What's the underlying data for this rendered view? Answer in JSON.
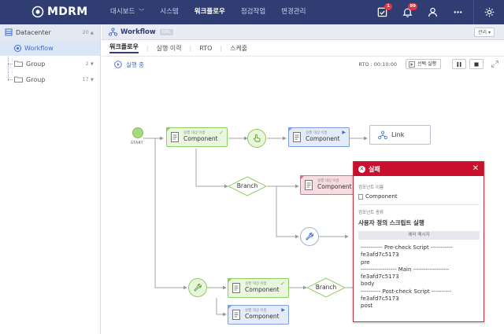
{
  "app": {
    "logo_text": "MDRM"
  },
  "topnav": {
    "items": [
      {
        "label": "대시보드",
        "has_dropdown": true
      },
      {
        "label": "시스템"
      },
      {
        "label": "워크플로우",
        "active": true
      },
      {
        "label": "점검작업"
      },
      {
        "label": "변경관리"
      }
    ],
    "icons": [
      {
        "name": "task-icon",
        "badge": "1"
      },
      {
        "name": "bell-icon",
        "badge": "99"
      },
      {
        "name": "user-icon"
      },
      {
        "name": "more-icon"
      },
      {
        "name": "settings-icon"
      }
    ]
  },
  "sidebar": {
    "header": {
      "label": "Datacenter",
      "count": "20"
    },
    "items": [
      {
        "label": "Workflow",
        "selected": true
      },
      {
        "label": "Group",
        "count": "2"
      },
      {
        "label": "Group",
        "count": "17"
      }
    ]
  },
  "main": {
    "title": "Workflow",
    "tag": "DRL",
    "manage_label": "관리",
    "tabs": [
      "워크플로우",
      "실행 이력",
      "RTO",
      "스케줄"
    ],
    "status_text": "실행 중",
    "rto_label": "RTO : 00:10:00",
    "select_run_label": "선택 실행"
  },
  "workflow": {
    "start_label": "START",
    "components": [
      {
        "sub": "실행 대상 이름",
        "name": "Component",
        "status": "success"
      },
      {
        "sub": "실행 대상 이름",
        "name": "Component",
        "status": "running"
      },
      {
        "sub": "실행 대상 이름",
        "name": "Component",
        "status": "failed"
      },
      {
        "sub": "실행 대상 이름",
        "name": "Component",
        "status": "success"
      },
      {
        "sub": "실행 대상 이름",
        "name": "Component",
        "status": "running"
      }
    ],
    "branches": [
      "Branch",
      "Branch"
    ],
    "link_label": "Link"
  },
  "error_panel": {
    "title": "실패",
    "component_label": "컴포넌트 이름",
    "component_value": "Component",
    "type_label": "컴포넌트 종류",
    "type_value": "사용자 정의 스크립트 실행",
    "message_header": "에러 메시지",
    "message": "----------- Pre-check Script -----------\nfe3afd7c5173\npre\n------------------ Main ------------------\nfe3afd7c5173\nbody\n---------- Post-check Script ----------\nfe3afd7c5173\npost"
  },
  "colors": {
    "topbar": "#2f3d73",
    "success": "#8ccd63",
    "running": "#3e6bd2",
    "failed": "#c8102e"
  }
}
